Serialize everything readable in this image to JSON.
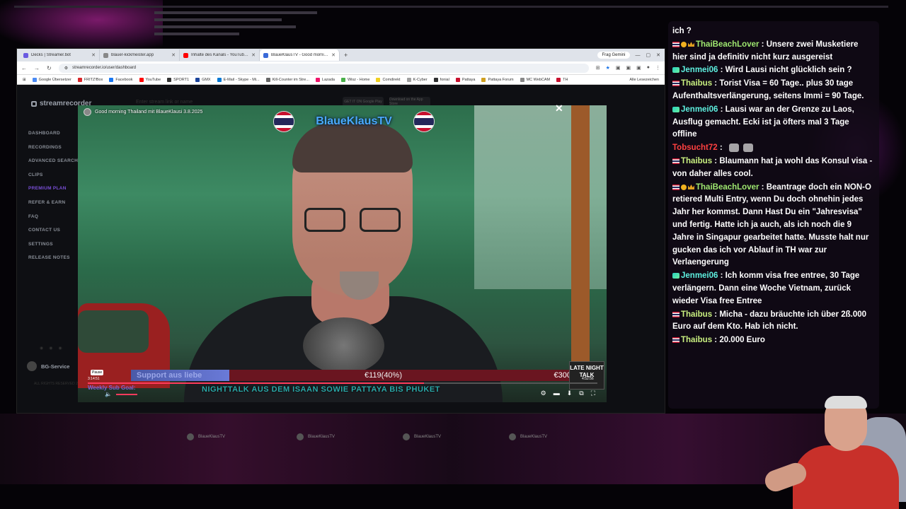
{
  "browser": {
    "tabs": [
      {
        "title": "Decks | Streamer.bot",
        "color": "#6a5ae0"
      },
      {
        "title": "blauer-kickmeister.app",
        "color": "#888888"
      },
      {
        "title": "Inhalte des Kanals - YouTube Studio",
        "color": "#ff0000"
      },
      {
        "title": "BlaueKlausTV - Good morning",
        "color": "#3a6ad8"
      }
    ],
    "new_tab": "+",
    "gemini": "Frag Gemini",
    "url": "streamrecorder.io/user/dashboard",
    "bookmarks": [
      {
        "label": "Google Übersetzer",
        "color": "#4a8af4"
      },
      {
        "label": "FRITZ!Box",
        "color": "#d8262a"
      },
      {
        "label": "Facebook",
        "color": "#1877f2"
      },
      {
        "label": "YouTube",
        "color": "#ff0000"
      },
      {
        "label": "SPORT1",
        "color": "#333333"
      },
      {
        "label": "GMX",
        "color": "#1c449b"
      },
      {
        "label": "E-Mail - Skype - Mi...",
        "color": "#0078d4"
      },
      {
        "label": "Kill-Counter im Stre...",
        "color": "#666666"
      },
      {
        "label": "Lazada",
        "color": "#f0146a"
      },
      {
        "label": "Wisz - Home",
        "color": "#4ab04a"
      },
      {
        "label": "Comdirekt",
        "color": "#f0d020"
      },
      {
        "label": "K-Cyber",
        "color": "#a0a0a0"
      },
      {
        "label": "fonial",
        "color": "#303030"
      },
      {
        "label": "Pattaya",
        "color": "#c8102e"
      },
      {
        "label": "Pattaya Forum",
        "color": "#d0a020"
      },
      {
        "label": "MC WebCAM",
        "color": "#888888"
      },
      {
        "label": "TH",
        "color": "#c8102e"
      }
    ],
    "bookmarks_right": "Alle Lesezeichen"
  },
  "app": {
    "logo": "streamrecorder",
    "search_hint": "Enter stream link or name",
    "store_badges": [
      "GET IT ON Google Play",
      "Download on the App Store"
    ],
    "sidebar": [
      "DASHBOARD",
      "RECORDINGS",
      "ADVANCED SEARCH",
      "CLIPS",
      "PREMIUM PLAN",
      "REFER & EARN",
      "FAQ",
      "CONTACT US",
      "SETTINGS",
      "RELEASE NOTES"
    ],
    "user": "BG-Service",
    "footer": "ALL RIGHTS RESERVED\n2020-08-05 1.0"
  },
  "video": {
    "title": "Good morning Thailand mit BlaueKlausi 3.8.2025",
    "brand": "BlaueKlausTV",
    "goal_label": "Support aus liebe",
    "goal_progress": "€119(40%)",
    "goal_fraction": 0.4,
    "goal_target": "€300",
    "marquee": "NIGHTTALK AUS DEM ISAAN SOWIE PATTAYA BIS PHUKET",
    "paused": "Pause",
    "time_current": "3:14:51",
    "time_total": "4:52:56",
    "scrub_fraction": 0.66,
    "sub_goal": "Weekly Sub Goal:",
    "late_night": "LATE NIGHT TALK",
    "channels": [
      "BlaueKlausTV",
      "BlaueKlausTV",
      "BlaueKlausTV",
      "BlaueKlausTV"
    ]
  },
  "chat": {
    "messages": [
      {
        "badges": [],
        "user": "",
        "text": "ich ?",
        "cls": ""
      },
      {
        "badges": [
          "flag",
          "coin",
          "crown"
        ],
        "user": "ThaiBeachLover",
        "text": " : Unsere zwei Musketiere hier sind ja definitiv nicht kurz ausgereist",
        "cls": "name-thaibeach"
      },
      {
        "badges": [
          "gem"
        ],
        "user": "Jenmei06",
        "text": " : Wird Lausi nicht glücklich sein ?",
        "cls": "name-jenmei"
      },
      {
        "badges": [
          "flag"
        ],
        "user": "Thaibus",
        "text": " : Torist Visa = 60 Tage.. plus 30 tage Aufenthaltsverlängerung, seitens Immi = 90 Tage.",
        "cls": "name-thaibus"
      },
      {
        "badges": [
          "gem"
        ],
        "user": "Jenmei06",
        "text": " : Lausi war an der Grenze zu Laos, Ausflug gemacht. Ecki ist ja öfters mal 3 Tage offline",
        "cls": "name-jenmei"
      },
      {
        "badges": [],
        "user": "Tobsucht72",
        "text": " : ",
        "cls": "name-tobsucht",
        "emotes": 2
      },
      {
        "badges": [
          "flag"
        ],
        "user": "Thaibus",
        "text": " : Blaumann hat ja wohl das Konsul visa - von daher alles cool.",
        "cls": "name-thaibus"
      },
      {
        "badges": [
          "flag",
          "coin",
          "crown"
        ],
        "user": "ThaiBeachLover",
        "text": " : Beantrage doch ein NON-O retiered Multi Entry, wenn Du doch ohnehin jedes Jahr her kommst. Dann Hast Du ein \"Jahresvisa\" und fertig. Hatte ich ja auch, als ich noch die 9 Jahre in Singapur gearbeitet hatte. Musste halt nur gucken das ich vor Ablauf in TH war zur Verlaengerung",
        "cls": "name-thaibeach"
      },
      {
        "badges": [
          "gem"
        ],
        "user": "Jenmei06",
        "text": " : Ich komm visa free entree, 30 Tage verlängern. Dann eine Woche Vietnam, zurück wieder Visa free Entree",
        "cls": "name-jenmei"
      },
      {
        "badges": [
          "flag"
        ],
        "user": "Thaibus",
        "text": " : Micha - dazu bräuchte ich über 2ß.000 Euro auf dem Kto. Hab ich nicht.",
        "cls": "name-thaibus"
      },
      {
        "badges": [
          "flag"
        ],
        "user": "Thaibus",
        "text": " : 20.000 Euro",
        "cls": "name-thaibus"
      }
    ]
  }
}
